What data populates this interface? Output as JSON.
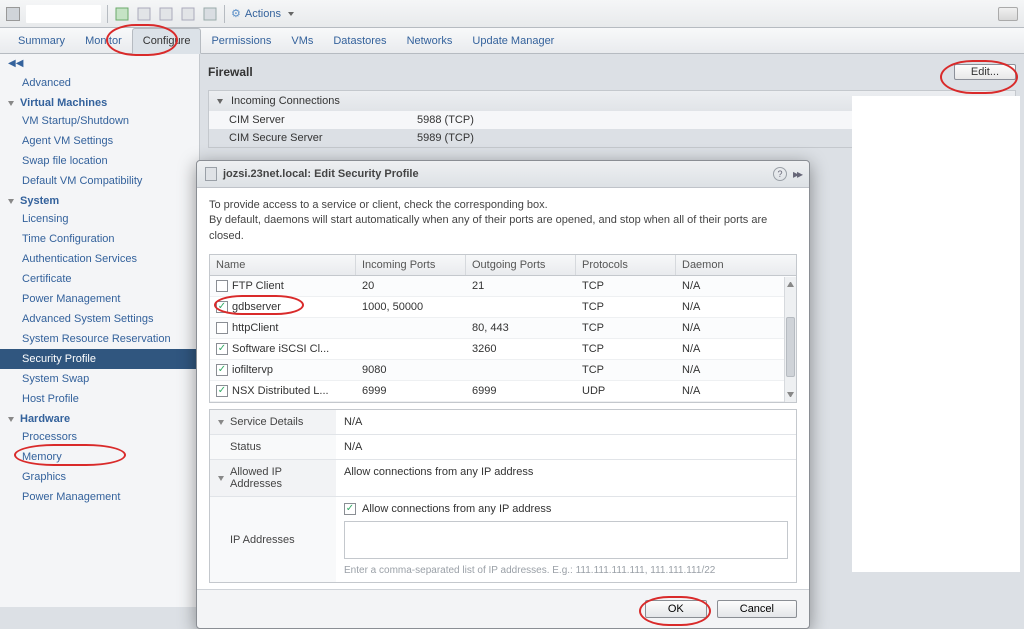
{
  "toolbar": {
    "actions_label": "Actions"
  },
  "tabs": [
    "Summary",
    "Monitor",
    "Configure",
    "Permissions",
    "VMs",
    "Datastores",
    "Networks",
    "Update Manager"
  ],
  "active_tab": "Configure",
  "sidebar": {
    "top": [
      "Advanced"
    ],
    "groups": [
      {
        "title": "Virtual Machines",
        "items": [
          "VM Startup/Shutdown",
          "Agent VM Settings",
          "Swap file location",
          "Default VM Compatibility"
        ]
      },
      {
        "title": "System",
        "items": [
          "Licensing",
          "Time Configuration",
          "Authentication Services",
          "Certificate",
          "Power Management",
          "Advanced System Settings",
          "System Resource Reservation",
          "Security Profile",
          "System Swap",
          "Host Profile"
        ]
      },
      {
        "title": "Hardware",
        "items": [
          "Processors",
          "Memory",
          "Graphics",
          "Power Management"
        ]
      }
    ],
    "selected": "Security Profile"
  },
  "content": {
    "title": "Firewall",
    "edit_btn": "Edit...",
    "section_title": "Incoming Connections",
    "rows": [
      {
        "name": "CIM Server",
        "port": "5988 (TCP)"
      },
      {
        "name": "CIM Secure Server",
        "port": "5989 (TCP)"
      }
    ]
  },
  "modal": {
    "title": "jozsi.23net.local: Edit Security Profile",
    "intro1": "To provide access to a service or client, check the corresponding box.",
    "intro2": "By default, daemons will start automatically when any of their ports are opened, and stop when all of their ports are closed.",
    "columns": {
      "name": "Name",
      "in": "Incoming Ports",
      "out": "Outgoing Ports",
      "proto": "Protocols",
      "daemon": "Daemon"
    },
    "rows": [
      {
        "checked": false,
        "name": "FTP Client",
        "in": "20",
        "out": "21",
        "proto": "TCP",
        "daemon": "N/A"
      },
      {
        "checked": true,
        "name": "gdbserver",
        "in": "1000, 50000",
        "out": "",
        "proto": "TCP",
        "daemon": "N/A"
      },
      {
        "checked": false,
        "name": "httpClient",
        "in": "",
        "out": "80, 443",
        "proto": "TCP",
        "daemon": "N/A"
      },
      {
        "checked": true,
        "name": "Software iSCSI Cl...",
        "in": "",
        "out": "3260",
        "proto": "TCP",
        "daemon": "N/A"
      },
      {
        "checked": true,
        "name": "iofiltervp",
        "in": "9080",
        "out": "",
        "proto": "TCP",
        "daemon": "N/A"
      },
      {
        "checked": true,
        "name": "NSX Distributed L...",
        "in": "6999",
        "out": "6999",
        "proto": "UDP",
        "daemon": "N/A"
      }
    ],
    "detail": {
      "service_details": "Service Details",
      "service_details_val": "N/A",
      "status": "Status",
      "status_val": "N/A",
      "allowed_ip": "Allowed IP Addresses",
      "allowed_ip_val": "Allow connections from any IP address",
      "ip_addresses": "IP Addresses",
      "allow_any_label": "Allow connections from any IP address",
      "allow_any_checked": true,
      "hint": "Enter a comma-separated list of IP addresses. E.g.: 111.111.111.111, 111.111.111/22"
    },
    "ok": "OK",
    "cancel": "Cancel"
  }
}
